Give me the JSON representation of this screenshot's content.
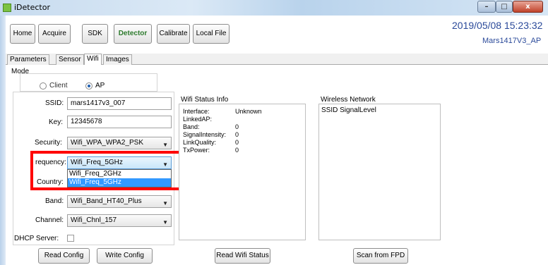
{
  "window": {
    "title": "iDetector",
    "min_label": "–",
    "max_label": "□",
    "close_label": "x"
  },
  "nav": {
    "buttons": [
      "Home",
      "Acquire",
      "SDK",
      "Detector",
      "Calibrate",
      "Local File"
    ],
    "active": "Detector",
    "datetime": "2019/05/08 15:23:32",
    "device": "Mars1417V3_AP"
  },
  "tabs": {
    "items": [
      "Parameters",
      "Sensor",
      "Wifi",
      "Images"
    ],
    "active": "Wifi"
  },
  "mode": {
    "title": "Mode",
    "client_label": "Client",
    "ap_label": "AP",
    "selected": "AP"
  },
  "form": {
    "ssid_label": "SSID:",
    "ssid_value": "mars1417v3_007",
    "key_label": "Key:",
    "key_value": "12345678",
    "security_label": "Security:",
    "security_value": "Wifi_WPA_WPA2_PSK",
    "frequency_label": "requency:",
    "frequency_value": "Wifi_Freq_5GHz",
    "frequency_options": [
      "Wifi_Freq_2GHz",
      "Wifi_Freq_5GHz"
    ],
    "frequency_selected": "Wifi_Freq_5GHz",
    "country_label": "Country:",
    "band_label": "Band:",
    "band_value": "Wifi_Band_HT40_Plus",
    "channel_label": "Channel:",
    "channel_value": "Wifi_Chnl_157",
    "dhcp_label": "DHCP Server:",
    "dhcp_checked": false
  },
  "buttons": {
    "read_config": "Read Config",
    "write_config": "Write Config",
    "read_wifi_status": "Read Wifi Status",
    "scan_from_fpd": "Scan from FPD"
  },
  "wifi_status": {
    "title": "Wifi Status Info",
    "rows": [
      {
        "key": "Interface:",
        "value": "Unknown"
      },
      {
        "key": "LinkedAP:",
        "value": ""
      },
      {
        "key": "Band:",
        "value": "0"
      },
      {
        "key": "SignalIntensity:",
        "value": "0"
      },
      {
        "key": "LinkQuality:",
        "value": "0"
      },
      {
        "key": "TxPower:",
        "value": "0"
      }
    ]
  },
  "wireless_network": {
    "title": "Wireless Network",
    "header": "SSID SignalLevel"
  },
  "colors": {
    "highlight_box": "#ff0000",
    "accent_blue": "#2b4a9a",
    "selection": "#3399ff"
  }
}
